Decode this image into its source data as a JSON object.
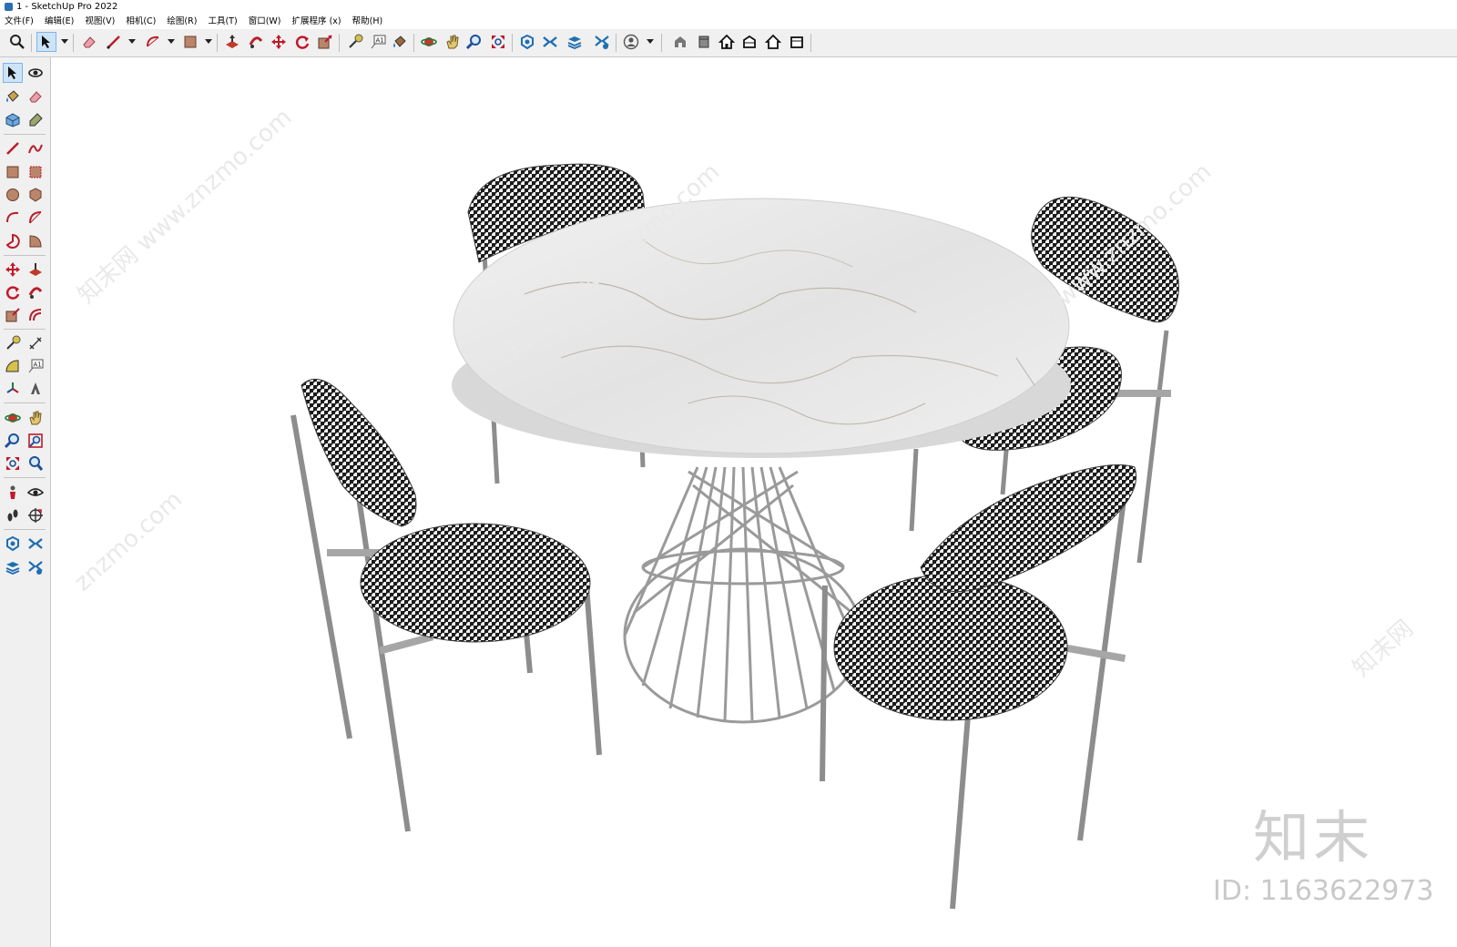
{
  "window": {
    "title": "1 - SketchUp Pro 2022",
    "app_icon": "sketchup-icon"
  },
  "menubar": {
    "items": [
      {
        "label": "文件(F)"
      },
      {
        "label": "编辑(E)"
      },
      {
        "label": "视图(V)"
      },
      {
        "label": "相机(C)"
      },
      {
        "label": "绘图(R)"
      },
      {
        "label": "工具(T)"
      },
      {
        "label": "窗口(W)"
      },
      {
        "label": "扩展程序 (x)"
      },
      {
        "label": "帮助(H)"
      }
    ]
  },
  "toolbar": {
    "tools": [
      "search-icon",
      "select-icon",
      "eraser-icon",
      "line-icon",
      "arc-icon",
      "rectangle-icon",
      "push-pull-icon",
      "follow-me-icon",
      "move-icon",
      "rotate-icon",
      "scale-icon",
      "tape-measure-icon",
      "text-icon",
      "paint-bucket-icon",
      "orbit-icon",
      "pan-icon",
      "zoom-icon",
      "zoom-extents-icon",
      "warehouse-icon",
      "extension-warehouse-icon",
      "layout-icon",
      "extension-manager-icon",
      "account-icon",
      "iso-view-icon",
      "top-view-icon",
      "front-view-icon",
      "right-view-icon",
      "back-view-icon",
      "left-view-icon"
    ],
    "active_tool": "select-icon"
  },
  "left_toolbar": {
    "tools": [
      "select-icon",
      "orbit-icon",
      "paint-bucket-icon",
      "eraser-icon",
      "component-icon",
      "tag-icon",
      "line-icon",
      "freehand-icon",
      "rectangle-icon",
      "rotated-rectangle-icon",
      "circle-icon",
      "polygon-icon",
      "arc-icon",
      "two-point-arc-icon",
      "pie-icon",
      "three-point-arc-icon",
      "move-icon",
      "push-pull-icon",
      "rotate-icon",
      "follow-me-icon",
      "scale-icon",
      "offset-icon",
      "tape-measure-icon",
      "dimension-icon",
      "protractor-icon",
      "text-icon",
      "axes-icon",
      "3d-text-icon",
      "orbit-icon",
      "pan-icon",
      "zoom-icon",
      "zoom-window-icon",
      "zoom-extents-icon",
      "previous-view-icon",
      "position-camera-icon",
      "look-around-icon",
      "walk-icon",
      "section-plane-icon",
      "warehouse-icon",
      "extension-warehouse-icon",
      "layout-icon",
      "extension-manager-icon"
    ]
  },
  "viewport": {
    "watermarks": [
      "知末网 www.znzmo.com",
      "知末网 www.znzmo.com",
      "知末网 www.znzmo.com",
      "znzmo.com",
      "知末网"
    ],
    "brand_mark": "知末",
    "brand_id": "ID: 1163622973"
  },
  "colors": {
    "toolbar_bg": "#f0f0f0",
    "canvas_bg": "#ffffff",
    "select_highlight": "#cde4f7",
    "metal": "#9a9a9a",
    "marble": "#e9e9e9"
  }
}
